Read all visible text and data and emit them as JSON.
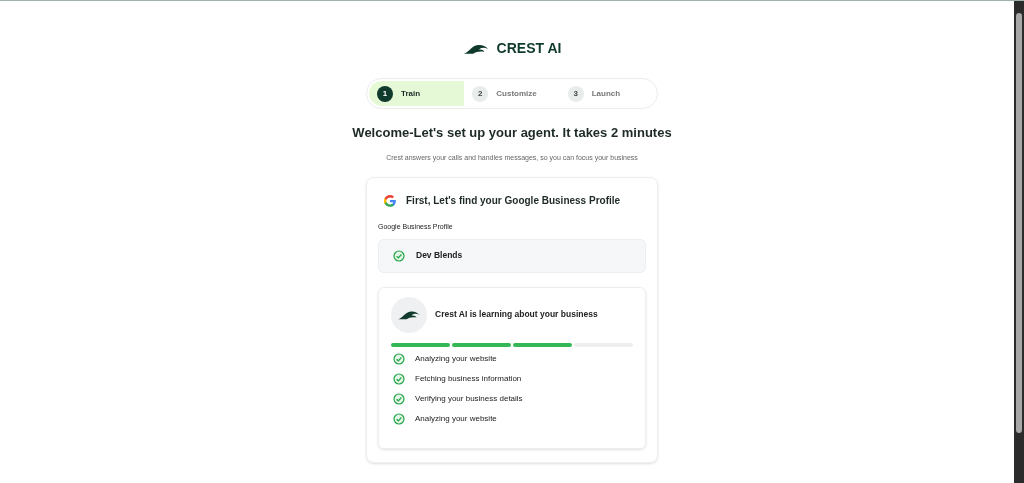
{
  "brand": {
    "name": "CREST AI"
  },
  "steps": [
    {
      "number": "1",
      "label": "Train",
      "selected": true
    },
    {
      "number": "2",
      "label": "Customize",
      "selected": false
    },
    {
      "number": "3",
      "label": "Launch",
      "selected": false
    }
  ],
  "heading": "Welcome-Let's set up your agent. It takes 2 minutes",
  "subtitle": "Crest answers your calls and handles messages, so you can focus your business",
  "card": {
    "title": "First, Let's find your Google Business Profile",
    "field_label": "Google Business Profile",
    "profile": {
      "name": "Dev Blends",
      "verified": true
    },
    "learning": {
      "title": "Crest AI is learning about your business",
      "segments": [
        {
          "done": true
        },
        {
          "done": true
        },
        {
          "done": true
        },
        {
          "done": false
        }
      ],
      "tasks": [
        {
          "label": "Analyzing your website",
          "done": true
        },
        {
          "label": "Fetching business information",
          "done": true
        },
        {
          "label": "Verifying your business details",
          "done": true
        },
        {
          "label": "Analyzing your website",
          "done": true
        }
      ]
    }
  }
}
